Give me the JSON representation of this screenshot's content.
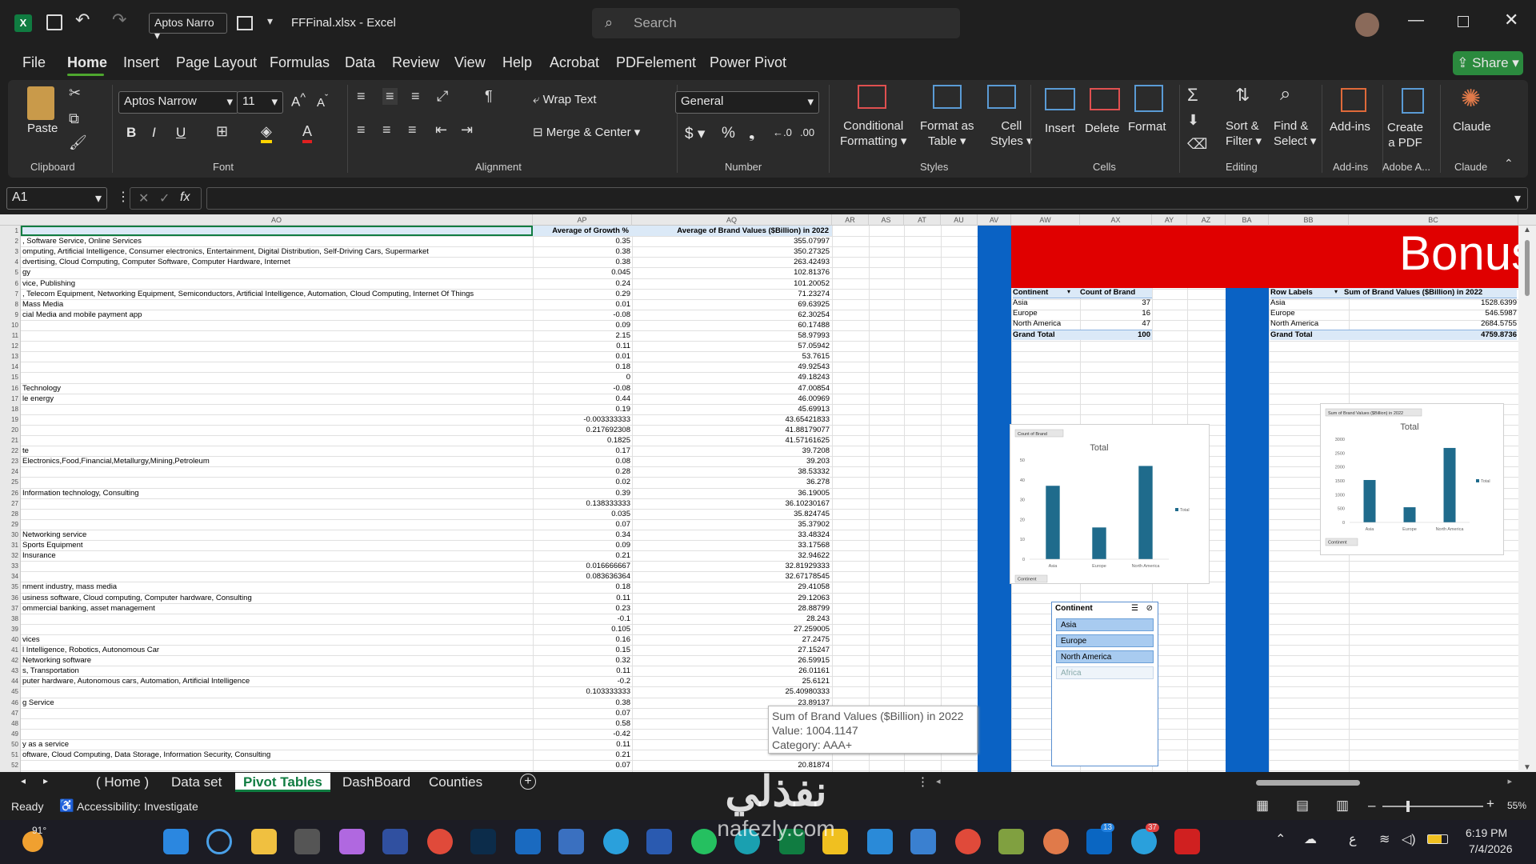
{
  "title": {
    "file": "FFFinal.xlsx",
    "sep": "-",
    "app": "Excel",
    "font_box": "Aptos Narro",
    "search_placeholder": "Search",
    "share": "Share"
  },
  "menu": [
    "File",
    "Home",
    "Insert",
    "Page Layout",
    "Formulas",
    "Data",
    "Review",
    "View",
    "Help",
    "Acrobat",
    "PDFelement",
    "Power Pivot"
  ],
  "ribbon": {
    "paste": "Paste",
    "clipboard": "Clipboard",
    "font_name": "Aptos Narrow",
    "font_size": "11",
    "font": "Font",
    "bold": "B",
    "italic": "I",
    "underline": "U",
    "wrap_text": "Wrap Text",
    "merge_center": "Merge & Center",
    "alignment": "Alignment",
    "number_format": "General",
    "number": "Number",
    "cond_fmt_1": "Conditional",
    "cond_fmt_2": "Formatting",
    "fmt_table_1": "Format as",
    "fmt_table_2": "Table",
    "cell_styles_1": "Cell",
    "cell_styles_2": "Styles",
    "styles": "Styles",
    "insert": "Insert",
    "delete": "Delete",
    "format": "Format",
    "cells": "Cells",
    "sort_1": "Sort &",
    "sort_2": "Filter",
    "find_1": "Find &",
    "find_2": "Select",
    "editing": "Editing",
    "addins": "Add-ins",
    "addins_grp": "Add-ins",
    "create_pdf_1": "Create",
    "create_pdf_2": "a PDF",
    "adobe": "Adobe A...",
    "claude": "Claude",
    "claude_grp": "Claude"
  },
  "formula_bar": {
    "name_box": "A1",
    "fx": "fx",
    "value": ""
  },
  "columns": [
    {
      "name": "AO"
    },
    {
      "name": "AP"
    },
    {
      "name": "AQ"
    },
    {
      "name": "AR"
    },
    {
      "name": "AS"
    },
    {
      "name": "AT"
    },
    {
      "name": "AU"
    },
    {
      "name": "AV"
    },
    {
      "name": "AW"
    },
    {
      "name": "AX"
    },
    {
      "name": "AY"
    },
    {
      "name": "AZ"
    },
    {
      "name": "BA"
    },
    {
      "name": "BB"
    },
    {
      "name": "BC"
    }
  ],
  "header_row": {
    "growth": "Average of Growth %",
    "brand": "Average of Brand Values ($Billion) in 2022"
  },
  "rows": [
    {
      "n": "1",
      "a": "",
      "g": "",
      "b": ""
    },
    {
      "n": "2",
      "a": ", Software Service, Online Services",
      "g": "0.35",
      "b": "355.07997"
    },
    {
      "n": "3",
      "a": "omputing, Artificial Intelligence, Consumer electronics, Entertainment, Digital Distribution, Self-Driving Cars, Supermarket",
      "g": "0.38",
      "b": "350.27325"
    },
    {
      "n": "4",
      "a": "dvertising, Cloud Computing, Computer Software, Computer Hardware, Internet",
      "g": "0.38",
      "b": "263.42493"
    },
    {
      "n": "5",
      "a": "gy",
      "g": "0.045",
      "b": "102.81376"
    },
    {
      "n": "6",
      "a": "vice, Publishing",
      "g": "0.24",
      "b": "101.20052"
    },
    {
      "n": "7",
      "a": ", Telecom Equipment, Networking Equipment, Semiconductors, Artificial Intelligence, Automation, Cloud Computing, Internet Of Things",
      "g": "0.29",
      "b": "71.23274"
    },
    {
      "n": "8",
      "a": "Mass Media",
      "g": "0.01",
      "b": "69.63925"
    },
    {
      "n": "9",
      "a": "cial Media and mobile payment app",
      "g": "-0.08",
      "b": "62.30254"
    },
    {
      "n": "10",
      "a": "",
      "g": "0.09",
      "b": "60.17488"
    },
    {
      "n": "11",
      "a": "",
      "g": "2.15",
      "b": "58.97993"
    },
    {
      "n": "12",
      "a": "",
      "g": "0.11",
      "b": "57.05942"
    },
    {
      "n": "13",
      "a": "",
      "g": "0.01",
      "b": "53.7615"
    },
    {
      "n": "14",
      "a": "",
      "g": "0.18",
      "b": "49.92543"
    },
    {
      "n": "15",
      "a": "",
      "g": "0",
      "b": "49.18243"
    },
    {
      "n": "16",
      "a": "Technology",
      "g": "-0.08",
      "b": "47.00854"
    },
    {
      "n": "17",
      "a": "le energy",
      "g": "0.44",
      "b": "46.00969"
    },
    {
      "n": "18",
      "a": "",
      "g": "0.19",
      "b": "45.69913"
    },
    {
      "n": "19",
      "a": "",
      "g": "-0.003333333",
      "b": "43.65421833"
    },
    {
      "n": "20",
      "a": "",
      "g": "0.217692308",
      "b": "41.88179077"
    },
    {
      "n": "21",
      "a": "",
      "g": "0.1825",
      "b": "41.57161625"
    },
    {
      "n": "22",
      "a": "te",
      "g": "0.17",
      "b": "39.7208"
    },
    {
      "n": "23",
      "a": "Electronics,Food,Financial,Metallurgy,Mining,Petroleum",
      "g": "0.08",
      "b": "39.203"
    },
    {
      "n": "24",
      "a": "",
      "g": "0.28",
      "b": "38.53332"
    },
    {
      "n": "25",
      "a": "",
      "g": "0.02",
      "b": "36.278"
    },
    {
      "n": "26",
      "a": "Information technology, Consulting",
      "g": "0.39",
      "b": "36.19005"
    },
    {
      "n": "27",
      "a": "",
      "g": "0.138333333",
      "b": "36.10230167"
    },
    {
      "n": "28",
      "a": "",
      "g": "0.035",
      "b": "35.824745"
    },
    {
      "n": "29",
      "a": "",
      "g": "0.07",
      "b": "35.37902"
    },
    {
      "n": "30",
      "a": "Networking service",
      "g": "0.34",
      "b": "33.48324"
    },
    {
      "n": "31",
      "a": "Sports Equipment",
      "g": "0.09",
      "b": "33.17568"
    },
    {
      "n": "32",
      "a": "Insurance",
      "g": "0.21",
      "b": "32.94622"
    },
    {
      "n": "33",
      "a": "",
      "g": "0.016666667",
      "b": "32.81929333"
    },
    {
      "n": "34",
      "a": "",
      "g": "0.083636364",
      "b": "32.67178545"
    },
    {
      "n": "35",
      "a": "nment industry, mass media",
      "g": "0.18",
      "b": "29.41058"
    },
    {
      "n": "36",
      "a": "usiness software, Cloud computing, Computer hardware, Consulting",
      "g": "0.11",
      "b": "29.12063"
    },
    {
      "n": "37",
      "a": "ommercial banking, asset management",
      "g": "0.23",
      "b": "28.88799"
    },
    {
      "n": "38",
      "a": "",
      "g": "-0.1",
      "b": "28.243"
    },
    {
      "n": "39",
      "a": "",
      "g": "0.105",
      "b": "27.259005"
    },
    {
      "n": "40",
      "a": "vices",
      "g": "0.16",
      "b": "27.2475"
    },
    {
      "n": "41",
      "a": "l Intelligence, Robotics, Autonomous Car",
      "g": "0.15",
      "b": "27.15247"
    },
    {
      "n": "42",
      "a": "Networking software",
      "g": "0.32",
      "b": "26.59915"
    },
    {
      "n": "43",
      "a": "s, Transportation",
      "g": "0.11",
      "b": "26.01161"
    },
    {
      "n": "44",
      "a": "puter hardware, Autonomous cars, Automation, Artificial Intelligence",
      "g": "-0.2",
      "b": "25.6121"
    },
    {
      "n": "45",
      "a": "",
      "g": "0.103333333",
      "b": "25.40980333"
    },
    {
      "n": "46",
      "a": "g Service",
      "g": "0.38",
      "b": "23.89137"
    },
    {
      "n": "47",
      "a": "",
      "g": "0.07",
      "b": ""
    },
    {
      "n": "48",
      "a": "",
      "g": "0.58",
      "b": ""
    },
    {
      "n": "49",
      "a": "",
      "g": "-0.42",
      "b": ""
    },
    {
      "n": "50",
      "a": "y as a service",
      "g": "0.11",
      "b": ""
    },
    {
      "n": "51",
      "a": "oftware, Cloud Computing, Data Storage, Information Security, Consulting",
      "g": "0.21",
      "b": ""
    },
    {
      "n": "52",
      "a": "",
      "g": "0.07",
      "b": "20.81874"
    }
  ],
  "bonus_title": "Bonus",
  "pivot1": {
    "h1": "Continent",
    "h2": "Count of Brand",
    "rows": [
      [
        "Asia",
        "37"
      ],
      [
        "Europe",
        "16"
      ],
      [
        "North America",
        "47"
      ]
    ],
    "total": [
      "Grand Total",
      "100"
    ]
  },
  "pivot2": {
    "h1": "Row Labels",
    "h2": "Sum of Brand Values ($Billion) in 2022",
    "rows": [
      [
        "Asia",
        "1528.6399"
      ],
      [
        "Europe",
        "546.5987"
      ],
      [
        "North America",
        "2684.5755"
      ]
    ],
    "total": [
      "Grand Total",
      "4759.8736"
    ]
  },
  "chart_data": [
    {
      "type": "bar",
      "title": "Total",
      "field_button": "Count of Brand",
      "axis_button": "Continent",
      "legend": "Total",
      "categories": [
        "Asia",
        "Europe",
        "North America"
      ],
      "values": [
        37,
        16,
        47
      ],
      "ylim": [
        0,
        50
      ],
      "yticks": [
        0,
        10,
        20,
        30,
        40,
        50
      ]
    },
    {
      "type": "bar",
      "title": "Total",
      "field_button": "Sum of Brand Values ($Billion) in 2022",
      "axis_button": "Continent",
      "legend": "Total",
      "categories": [
        "Asia",
        "Europe",
        "North America"
      ],
      "values": [
        1528.64,
        546.6,
        2684.58
      ],
      "ylim": [
        0,
        3000
      ],
      "yticks": [
        0,
        500,
        1000,
        1500,
        2000,
        2500,
        3000
      ]
    }
  ],
  "slicer": {
    "title": "Continent",
    "items": [
      "Asia",
      "Europe",
      "North America",
      "Africa"
    ],
    "selected": [
      true,
      true,
      true,
      false
    ]
  },
  "tooltip": {
    "l1": "Sum of Brand Values ($Billion) in 2022",
    "l2": "Value: 1004.1147",
    "l3": "Category: AAA+"
  },
  "sheets": [
    "( Home )",
    "Data set",
    "Pivot Tables",
    "DashBoard",
    "Counties"
  ],
  "active_sheet": "Pivot Tables",
  "status": {
    "ready": "Ready",
    "accessibility": "Accessibility: Investigate",
    "zoom": "55%"
  },
  "taskbar": {
    "weather": "91°",
    "time": "6:19 PM",
    "date": "7/4/2026",
    "lang": "ع",
    "badge_in": "13",
    "badge_tg": "37"
  },
  "watermark": {
    "ar": "نفذلي",
    "url": "nafezly.com"
  }
}
